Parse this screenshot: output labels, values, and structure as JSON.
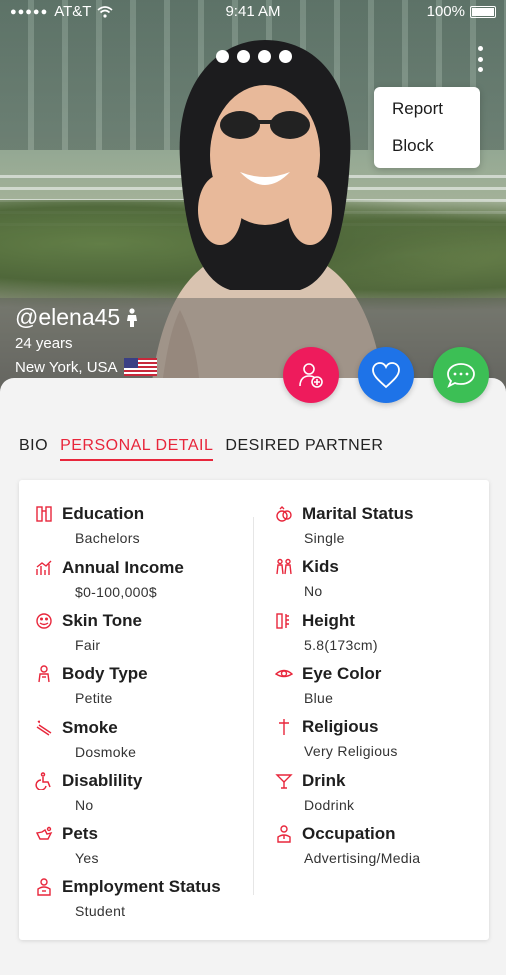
{
  "status_bar": {
    "carrier": "AT&T",
    "time": "9:41 AM",
    "battery": "100%"
  },
  "overflow_menu": {
    "items": [
      "Report",
      "Block"
    ]
  },
  "profile": {
    "username": "@elena45",
    "age": "24 years",
    "location": "New York, USA"
  },
  "tabs": [
    {
      "label": "BIO",
      "active": false
    },
    {
      "label": "PERSONAL DETAIL",
      "active": true
    },
    {
      "label": "DESIRED PARTNER",
      "active": false
    }
  ],
  "details_left": [
    {
      "title": "Education",
      "value": "Bachelors",
      "icon": "education-icon"
    },
    {
      "title": "Annual Income",
      "value": "$0-100,000$",
      "icon": "income-icon"
    },
    {
      "title": "Skin Tone",
      "value": "Fair",
      "icon": "skin-tone-icon"
    },
    {
      "title": "Body Type",
      "value": "Petite",
      "icon": "body-type-icon"
    },
    {
      "title": "Smoke",
      "value": "Dosmoke",
      "icon": "smoke-icon"
    },
    {
      "title": "Disablility",
      "value": "No",
      "icon": "disability-icon"
    },
    {
      "title": "Pets",
      "value": "Yes",
      "icon": "pets-icon"
    },
    {
      "title": "Employment Status",
      "value": "Student",
      "icon": "employment-icon"
    }
  ],
  "details_right": [
    {
      "title": "Marital Status",
      "value": "Single",
      "icon": "rings-icon"
    },
    {
      "title": "Kids",
      "value": "No",
      "icon": "kids-icon"
    },
    {
      "title": "Height",
      "value": "5.8(173cm)",
      "icon": "height-icon"
    },
    {
      "title": "Eye Color",
      "value": "Blue",
      "icon": "eye-icon"
    },
    {
      "title": "Religious",
      "value": "Very Religious",
      "icon": "cross-icon"
    },
    {
      "title": "Drink",
      "value": "Dodrink",
      "icon": "cocktail-icon"
    },
    {
      "title": "Occupation",
      "value": "Advertising/Media",
      "icon": "occupation-icon"
    }
  ],
  "colors": {
    "accent": "#e8263b",
    "add_user": "#ee1b5c",
    "like": "#1e73e8",
    "chat": "#3cbf55"
  }
}
